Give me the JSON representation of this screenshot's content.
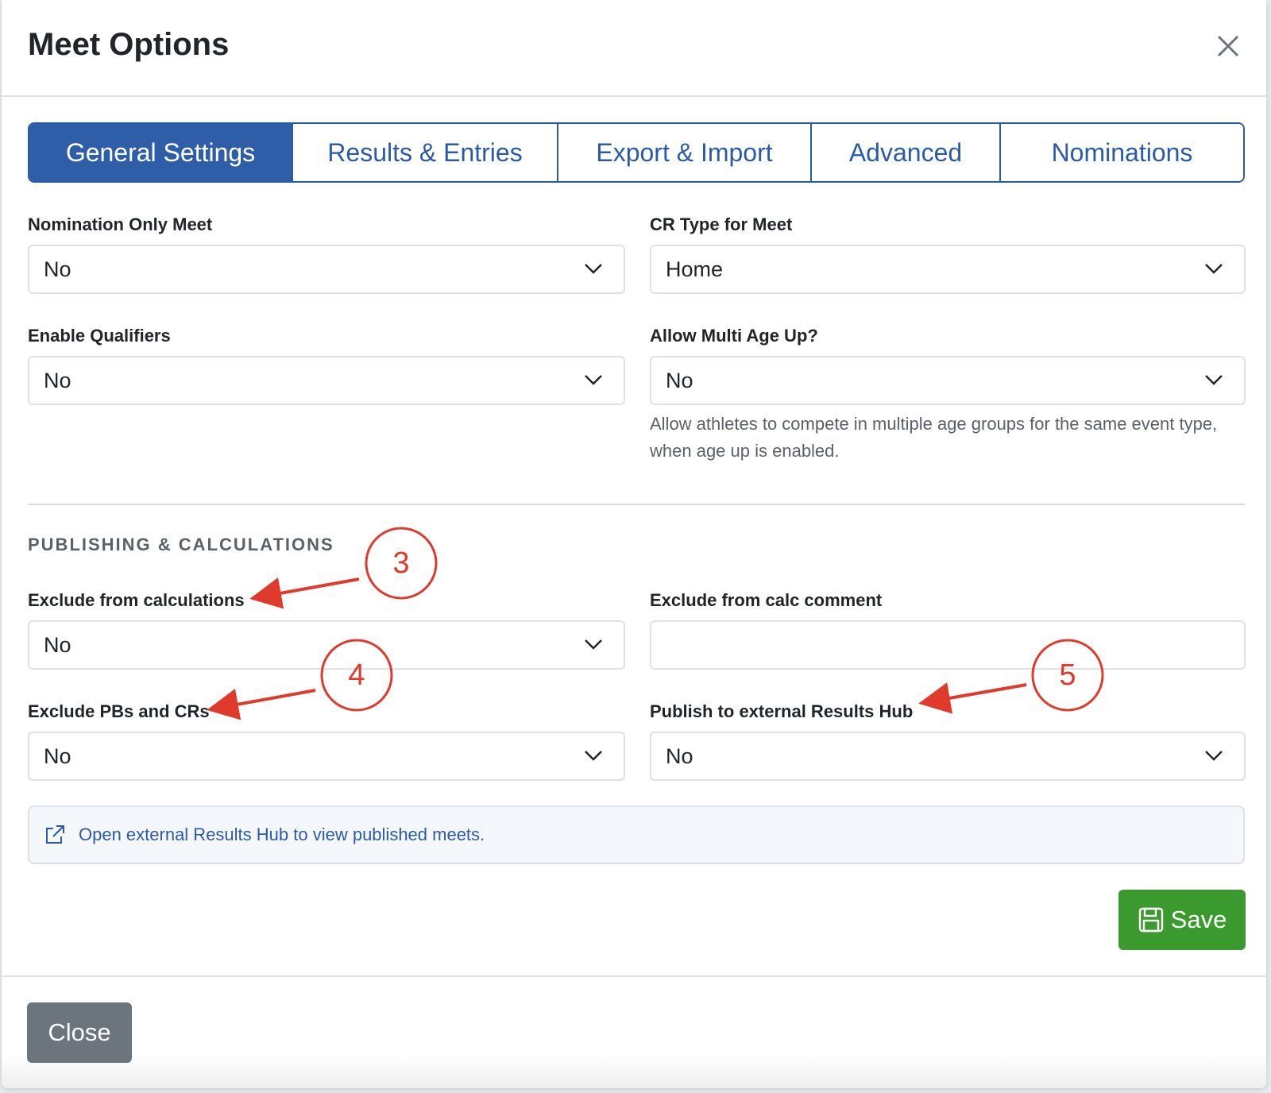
{
  "modal": {
    "title": "Meet Options"
  },
  "tabs": [
    {
      "label": "General Settings",
      "active": true
    },
    {
      "label": "Results & Entries",
      "active": false
    },
    {
      "label": "Export & Import",
      "active": false
    },
    {
      "label": "Advanced",
      "active": false
    },
    {
      "label": "Nominations",
      "active": false
    }
  ],
  "general": {
    "nomination_only_meet": {
      "label": "Nomination Only Meet",
      "value": "No"
    },
    "cr_type": {
      "label": "CR Type for Meet",
      "value": "Home"
    },
    "enable_qualifiers": {
      "label": "Enable Qualifiers",
      "value": "No"
    },
    "allow_multi_age_up": {
      "label": "Allow Multi Age Up?",
      "value": "No",
      "help": "Allow athletes to compete in multiple age groups for the same event type, when age up is enabled."
    }
  },
  "publishing": {
    "section_title": "PUBLISHING & CALCULATIONS",
    "exclude_calculations": {
      "label": "Exclude from calculations",
      "value": "No"
    },
    "exclude_calc_comment": {
      "label": "Exclude from calc comment",
      "value": ""
    },
    "exclude_pbs_crs": {
      "label": "Exclude PBs and CRs",
      "value": "No"
    },
    "publish_results_hub": {
      "label": "Publish to external Results Hub",
      "value": "No"
    },
    "results_hub_link": "Open external Results Hub to view published meets."
  },
  "buttons": {
    "save": "Save",
    "close": "Close"
  },
  "annotations": [
    "3",
    "4",
    "5"
  ],
  "colors": {
    "primary": "#2f5ea9",
    "success": "#3a9a2e",
    "secondary": "#6c757d",
    "annotation": "#e03a2c"
  }
}
